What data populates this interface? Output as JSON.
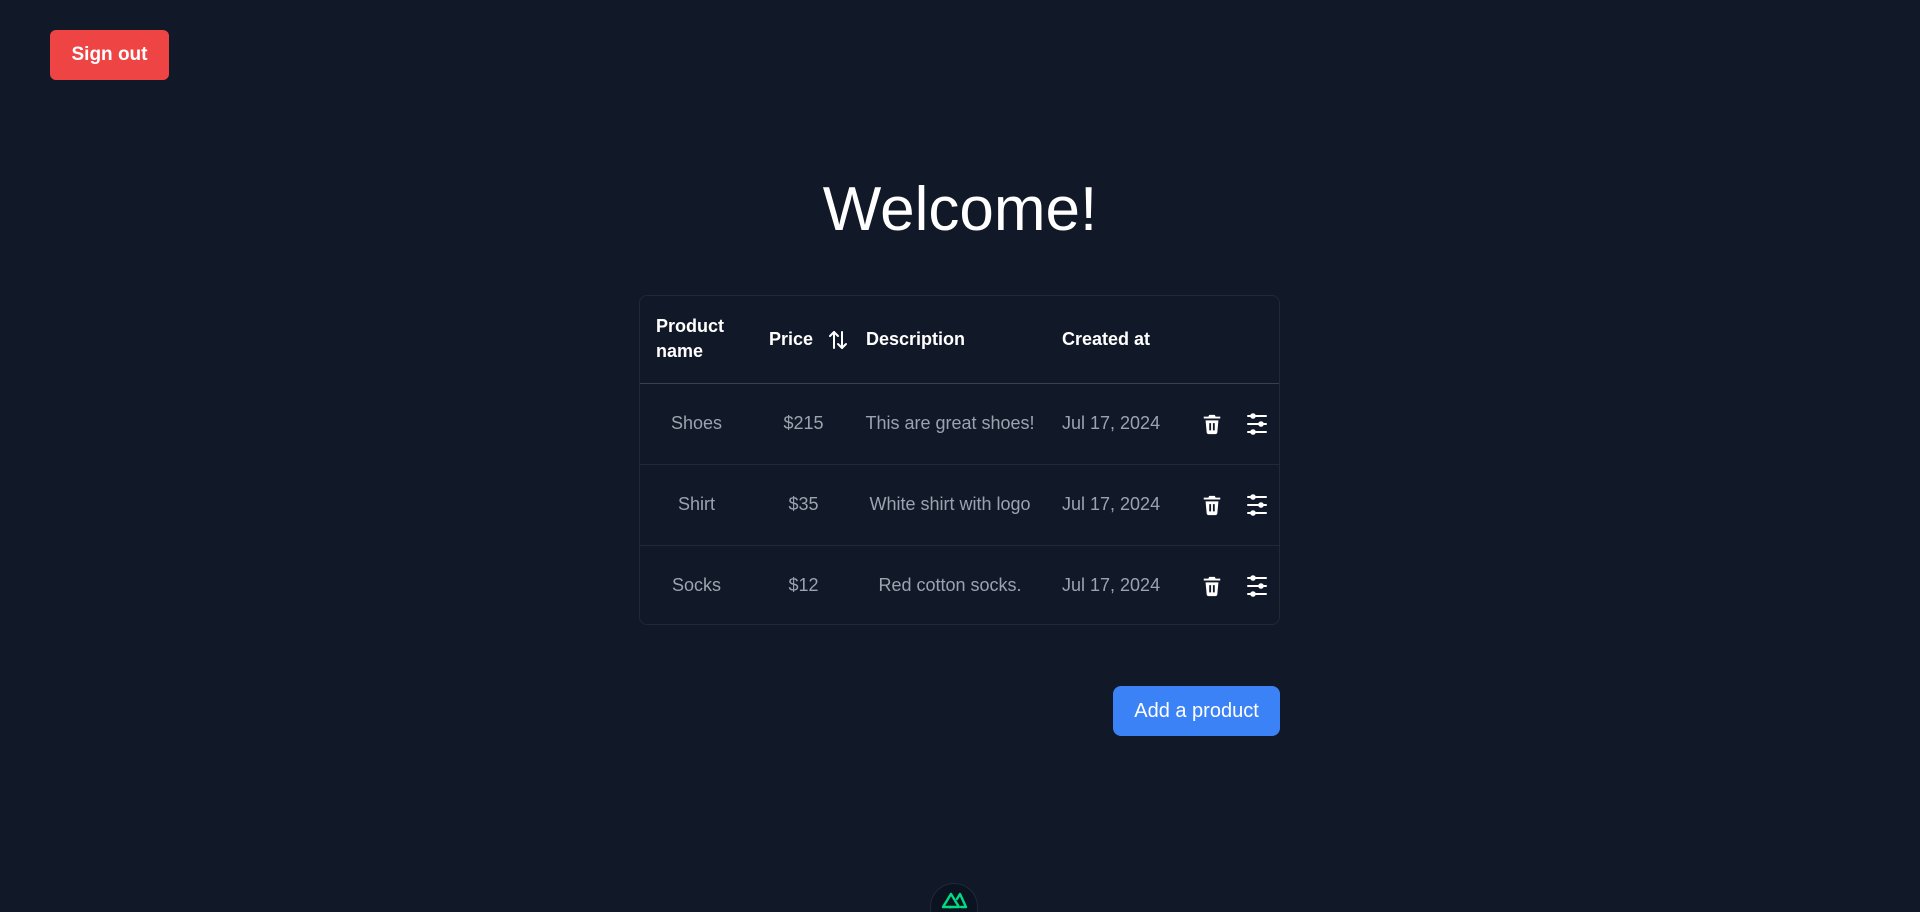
{
  "header": {
    "signout_label": "Sign out"
  },
  "main": {
    "title": "Welcome!",
    "table": {
      "columns": {
        "name": "Product name",
        "price": "Price",
        "description": "Description",
        "created": "Created at"
      },
      "rows": [
        {
          "name": "Shoes",
          "price": "$215",
          "description": "This are great shoes!",
          "created": "Jul 17, 2024"
        },
        {
          "name": "Shirt",
          "price": "$35",
          "description": "White shirt with logo",
          "created": "Jul 17, 2024"
        },
        {
          "name": "Socks",
          "price": "$12",
          "description": "Red cotton socks.",
          "created": "Jul 17, 2024"
        }
      ]
    },
    "add_label": "Add a product"
  },
  "icons": {
    "sort": "sort-arrows-icon",
    "delete": "trash-icon",
    "edit": "sliders-icon",
    "badge": "nuxt-logo-icon"
  },
  "colors": {
    "background": "#111827",
    "signout": "#ef4444",
    "primary": "#3b82f6",
    "muted_text": "#9ca3af",
    "nuxt_green": "#00dc82"
  }
}
